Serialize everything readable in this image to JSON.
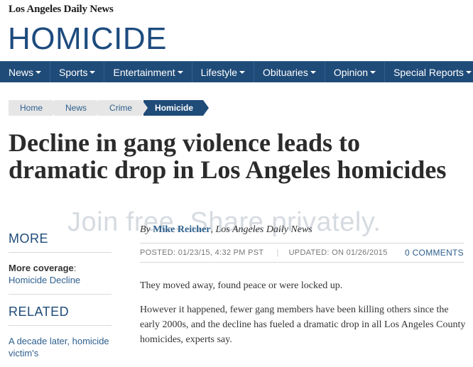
{
  "masthead": {
    "brand": "Los Angeles Daily News",
    "section_title": "HOMICIDE"
  },
  "nav": {
    "items": [
      "News",
      "Sports",
      "Entertainment",
      "Lifestyle",
      "Obituaries",
      "Opinion",
      "Special Reports"
    ]
  },
  "breadcrumb": [
    "Home",
    "News",
    "Crime",
    "Homicide"
  ],
  "article": {
    "headline": "Decline in gang violence leads to dramatic drop in Los Angeles homicides",
    "byline_prefix": "By",
    "author": "Mike Reicher",
    "outlet": ", Los Angeles Daily News",
    "posted": "POSTED: 01/23/15, 4:32 PM PST",
    "updated": "UPDATED: ON 01/26/2015",
    "comments": "0 COMMENTS",
    "paragraphs": [
      "They moved away, found peace or were locked up.",
      "However it happened, fewer gang members have been killing others since the early 2000s, and the decline has fueled a dramatic drop in all Los Angeles County homicides, experts say."
    ]
  },
  "sidebar": {
    "more_heading": "MORE",
    "more_label": "More coverage",
    "more_colon": ":",
    "more_link": "Homicide Decline",
    "related_heading": "RELATED",
    "related_link": "A decade later, homicide victim's"
  },
  "watermark": "Join free. Share privately."
}
